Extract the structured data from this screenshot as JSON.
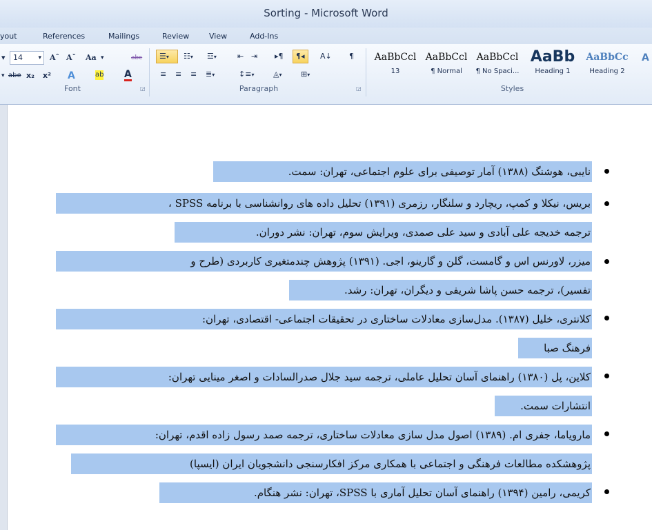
{
  "window": {
    "title": "Sorting  -  Microsoft Word"
  },
  "tabs": [
    "yout",
    "References",
    "Mailings",
    "Review",
    "View",
    "Add-Ins"
  ],
  "ribbon": {
    "font": {
      "label": "Font",
      "size": "14",
      "grow_glyph": "Aˆ",
      "shrink_glyph": "Aˇ",
      "case_glyph": "Aa",
      "clear_glyph": "abc",
      "strike_glyph": "abe",
      "sub_glyph": "x₂",
      "sup_glyph": "x²",
      "effects_glyph": "A",
      "highlight_glyph": "ab",
      "fontcolor_glyph": "A"
    },
    "paragraph": {
      "label": "Paragraph"
    },
    "styles": {
      "label": "Styles",
      "items": [
        {
          "sample": "AaBbCcl",
          "name": "13"
        },
        {
          "sample": "AaBbCcl",
          "name": "¶ Normal"
        },
        {
          "sample": "AaBbCcl",
          "name": "¶ No Spaci..."
        },
        {
          "sample": "AaBb",
          "name": "Heading 1"
        },
        {
          "sample": "AaBbCc",
          "name": "Heading 2"
        }
      ]
    }
  },
  "document": {
    "lines": [
      "نایبی، هوشنگ (۱۳۸۸) آمار توصیفی برای علوم اجتماعی، تهران: سمت.",
      "بریس، نیکلا و کمپ، ریچارد و سلنگار، رزمری (۱۳۹۱) تحلیل داده های روانشناسی با برنامه SPSS ،",
      "ترجمه خدیجه علی آبادی و سید علی صمدی، ویرایش سوم، تهران: نشر دوران.",
      "میزر، لاورنس اس و گامست، گلن و گارینو، اجی. (۱۳۹۱) پژوهش چندمتغیری کاربردی (طرح و",
      "تفسیر)، ترجمه حسن پاشا شریفی و دیگران، تهران: رشد.",
      "کلانتری، خلیل (۱۳۸۷). مدل‌سازی معادلات ساختاری در تحقیقات اجتماعی- اقتصادی، تهران:",
      "فرهنگ صبا",
      "کلاین، پل (۱۳۸۰) راهنمای آسان تحلیل عاملی، ترجمه سید جلال صدرالسادات و اصغر مینایی تهران:",
      "انتشارات سمت.",
      "مارویاما، جفری ام. (۱۳۸۹) اصول مدل سازی معادلات ساختاری، ترجمه صمد رسول زاده اقدم، تهران:",
      "پژوهشکده مطالعات فرهنگی و اجتماعی با همکاری مرکز افکارسنجی دانشجویان ایران (ایسپا)",
      "کریمی، رامین (۱۳۹۴) راهنمای آسان تحلیل آماری با SPSS، تهران: نشر هنگام."
    ]
  }
}
